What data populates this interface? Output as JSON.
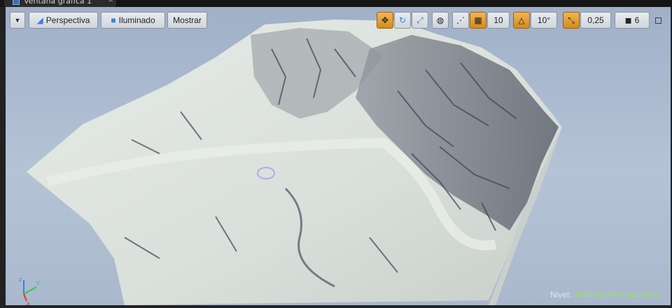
{
  "tab": {
    "title": "Ventana gráfica 1",
    "close": "×"
  },
  "toolbar": {
    "menu_icon": "chevron-down-icon",
    "perspective_label": "Perspectiva",
    "lit_label": "Iluminado",
    "show_label": "Mostrar",
    "grid_snap_value": "10",
    "rotation_snap_value": "10°",
    "scale_snap_value": "0,25",
    "camera_speed_value": "6"
  },
  "status": {
    "level_key": "Nivel:",
    "level_value": "Untitled (Permanente)"
  },
  "colors": {
    "accent": "#e39a2a",
    "level_value": "#9be06a",
    "sky": "#b2c0d4",
    "terrain": "#d8ddd8"
  }
}
